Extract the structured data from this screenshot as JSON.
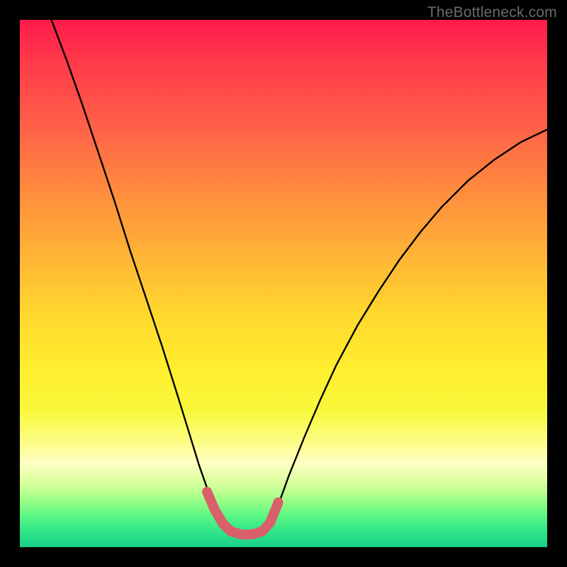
{
  "watermark": {
    "text": "TheBottleneck.com"
  },
  "chart_data": {
    "type": "line",
    "title": "",
    "xlabel": "",
    "ylabel": "",
    "xlim": [
      0,
      1
    ],
    "ylim": [
      0,
      1
    ],
    "series": [
      {
        "name": "main-curve",
        "x": [
          0.06,
          0.09,
          0.12,
          0.15,
          0.18,
          0.21,
          0.24,
          0.27,
          0.3,
          0.32,
          0.34,
          0.36,
          0.385,
          0.4,
          0.42,
          0.44,
          0.46,
          0.475,
          0.49,
          0.51,
          0.54,
          0.57,
          0.6,
          0.64,
          0.68,
          0.72,
          0.76,
          0.8,
          0.85,
          0.9,
          0.95,
          1.0
        ],
        "y": [
          1.0,
          0.92,
          0.835,
          0.745,
          0.655,
          0.56,
          0.47,
          0.38,
          0.285,
          0.22,
          0.155,
          0.098,
          0.045,
          0.03,
          0.024,
          0.024,
          0.03,
          0.047,
          0.08,
          0.135,
          0.21,
          0.28,
          0.345,
          0.42,
          0.485,
          0.545,
          0.598,
          0.645,
          0.695,
          0.735,
          0.768,
          0.792
        ]
      },
      {
        "name": "highlight-segment",
        "x": [
          0.355,
          0.37,
          0.385,
          0.4,
          0.42,
          0.44,
          0.46,
          0.475,
          0.49
        ],
        "y": [
          0.105,
          0.07,
          0.045,
          0.03,
          0.024,
          0.024,
          0.03,
          0.047,
          0.085
        ]
      }
    ],
    "colors": {
      "curve": "#000000",
      "highlight": "#d9606a",
      "gradient_top": "#ff1a4b",
      "gradient_bottom": "#18cf8a"
    }
  }
}
